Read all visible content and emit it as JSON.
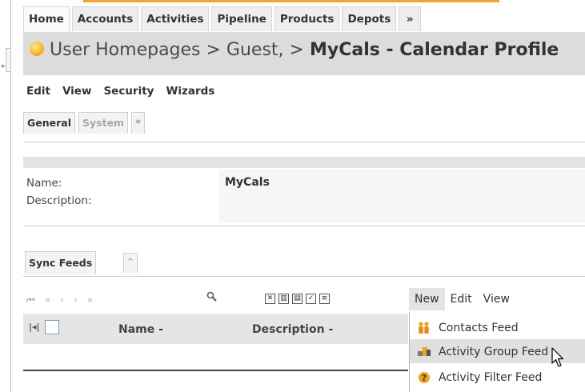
{
  "tabs": [
    "Home",
    "Accounts",
    "Activities",
    "Pipeline",
    "Products",
    "Depots",
    "»"
  ],
  "breadcrumb": {
    "prefix": "User Homepages > Guest, > ",
    "current": "MyCals - Calendar Profile"
  },
  "menu": [
    "Edit",
    "View",
    "Security",
    "Wizards"
  ],
  "subtabs": [
    "General",
    "System",
    "*"
  ],
  "form": {
    "name_label": "Name:",
    "name_value": "MyCals",
    "description_label": "Description:",
    "description_value": ""
  },
  "sync": {
    "tab_label": "Sync Feeds",
    "toggle": "^"
  },
  "pager": [
    "⏮",
    "«",
    "‹",
    "›",
    "»"
  ],
  "list_menu": [
    "New",
    "Edit",
    "View"
  ],
  "columns": {
    "name": "Name",
    "description": "Description",
    "sort_marker": "-"
  },
  "new_menu": {
    "items": [
      {
        "label": "Contacts Feed",
        "icon": "contacts-icon"
      },
      {
        "label": "Activity Group Feed",
        "icon": "activity-group-icon"
      },
      {
        "label": "Activity Filter Feed",
        "icon": "activity-filter-icon"
      }
    ],
    "selected_index": 1
  },
  "colors": {
    "accent_orange": "#f4a433",
    "titlebar_bg": "#dcdcdc",
    "header_bg": "#e5e5e5"
  }
}
